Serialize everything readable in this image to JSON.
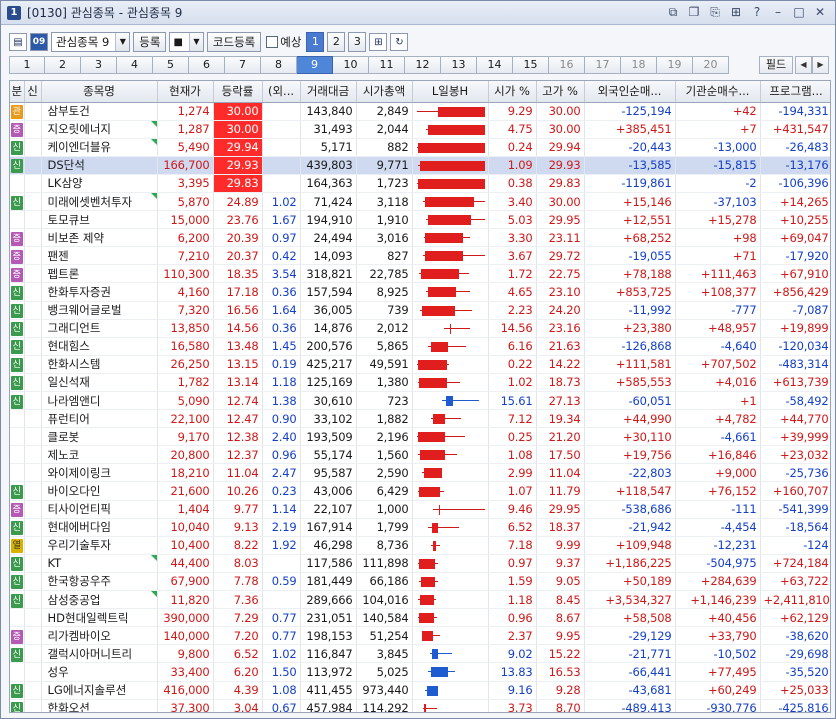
{
  "window": {
    "number": "1",
    "title": "[0130] 관심종목 - 관심종목 9",
    "controls": [
      "restore-icon",
      "copy-icon",
      "link-icon",
      "grid-icon",
      "help-icon",
      "minimize-icon",
      "maximize-icon",
      "close-icon"
    ]
  },
  "toolbar": {
    "group_select": "관심종목 9",
    "register_label": "등록",
    "code_register_label": "코드등록",
    "forecast_label": "예상",
    "pages": [
      "1",
      "2",
      "3"
    ],
    "active_page": "1"
  },
  "tabs": {
    "items": [
      "1",
      "2",
      "3",
      "4",
      "5",
      "6",
      "7",
      "8",
      "9",
      "10",
      "11",
      "12",
      "13",
      "14",
      "15",
      "16",
      "17",
      "18",
      "19",
      "20"
    ],
    "active": "9",
    "dim": [
      "16",
      "17",
      "18",
      "19",
      "20"
    ],
    "field_label": "필드"
  },
  "grid": {
    "headers": [
      "분",
      "신",
      "종목명",
      "현재가",
      "등락률",
      "(외...",
      "거래대금",
      "시가총액",
      "L일봉H",
      "시가 %",
      "고가 %",
      "외국인순매...",
      "기관순매수...",
      "프로그램..."
    ],
    "rows": [
      {
        "cat": "관",
        "name": "삼부토건",
        "price": "1,274",
        "rate": "30.00",
        "hot": true,
        "frgn": "",
        "amount": "143,840",
        "mcap": "2,849",
        "open": "9.29",
        "high": "30.00",
        "fnet": "-125,194",
        "inet": "+42",
        "pnet": "-194,331",
        "flag": false,
        "candle": {
          "o": 9.29,
          "c": 30.0,
          "h": 30.0,
          "l": 0.0
        }
      },
      {
        "cat": "증",
        "name": "지오릿에너지",
        "price": "1,287",
        "rate": "30.00",
        "hot": true,
        "frgn": "",
        "amount": "31,493",
        "mcap": "2,044",
        "open": "4.75",
        "high": "30.00",
        "fnet": "+385,451",
        "inet": "+7",
        "pnet": "+431,547",
        "flag": true,
        "candle": {
          "o": 4.75,
          "c": 30.0,
          "h": 30.0,
          "l": 4.0
        }
      },
      {
        "cat": "신",
        "name": "케이엔더블유",
        "price": "5,490",
        "rate": "29.94",
        "hot": true,
        "frgn": "",
        "amount": "5,171",
        "mcap": "882",
        "open": "0.24",
        "high": "29.94",
        "fnet": "-20,443",
        "inet": "-13,000",
        "pnet": "-26,483",
        "flag": true,
        "candle": {
          "o": 0.24,
          "c": 29.94,
          "h": 29.94,
          "l": 0.0
        }
      },
      {
        "cat": "신",
        "name": "DS단석",
        "price": "166,700",
        "rate": "29.93",
        "hot": true,
        "frgn": "",
        "amount": "439,803",
        "mcap": "9,771",
        "open": "1.09",
        "high": "29.93",
        "fnet": "-13,585",
        "inet": "-15,815",
        "pnet": "-13,176",
        "flag": false,
        "selected": true,
        "candle": {
          "o": 1.09,
          "c": 29.93,
          "h": 29.93,
          "l": 0.5
        }
      },
      {
        "cat": "",
        "name": "LK삼양",
        "price": "3,395",
        "rate": "29.83",
        "hot": true,
        "frgn": "",
        "amount": "164,363",
        "mcap": "1,723",
        "open": "0.38",
        "high": "29.83",
        "fnet": "-119,861",
        "inet": "-2",
        "pnet": "-106,396",
        "flag": false,
        "candle": {
          "o": 0.38,
          "c": 29.83,
          "h": 29.83,
          "l": 0.0
        }
      },
      {
        "cat": "신",
        "name": "미래에셋벤처투자",
        "price": "5,870",
        "rate": "24.89",
        "hot": false,
        "frgn": "1.02",
        "amount": "71,424",
        "mcap": "3,118",
        "open": "3.40",
        "high": "30.00",
        "fnet": "+15,146",
        "inet": "-37,103",
        "pnet": "+14,265",
        "flag": true,
        "candle": {
          "o": 3.4,
          "c": 24.89,
          "h": 30.0,
          "l": 2.5
        }
      },
      {
        "cat": "",
        "name": "토모큐브",
        "price": "15,000",
        "rate": "23.76",
        "hot": false,
        "frgn": "1.67",
        "amount": "194,910",
        "mcap": "1,910",
        "open": "5.03",
        "high": "29.95",
        "fnet": "+12,551",
        "inet": "+15,278",
        "pnet": "+10,255",
        "flag": false,
        "candle": {
          "o": 5.03,
          "c": 23.76,
          "h": 29.95,
          "l": 4.0
        }
      },
      {
        "cat": "증",
        "name": "비보존 제약",
        "price": "6,200",
        "rate": "20.39",
        "hot": false,
        "frgn": "0.97",
        "amount": "24,494",
        "mcap": "3,016",
        "open": "3.30",
        "high": "23.11",
        "fnet": "+68,252",
        "inet": "+98",
        "pnet": "+69,047",
        "flag": false,
        "candle": {
          "o": 3.3,
          "c": 20.39,
          "h": 23.11,
          "l": 3.0
        }
      },
      {
        "cat": "증",
        "name": "팬젠",
        "price": "7,210",
        "rate": "20.37",
        "hot": false,
        "frgn": "0.42",
        "amount": "14,093",
        "mcap": "827",
        "open": "3.67",
        "high": "29.72",
        "fnet": "-19,055",
        "inet": "+71",
        "pnet": "-17,920",
        "flag": false,
        "candle": {
          "o": 3.67,
          "c": 20.37,
          "h": 29.72,
          "l": 2.5
        }
      },
      {
        "cat": "증",
        "name": "펩트론",
        "price": "110,300",
        "rate": "18.35",
        "hot": false,
        "frgn": "3.54",
        "amount": "318,821",
        "mcap": "22,785",
        "open": "1.72",
        "high": "22.75",
        "fnet": "+78,188",
        "inet": "+111,463",
        "pnet": "+67,910",
        "flag": false,
        "candle": {
          "o": 1.72,
          "c": 18.35,
          "h": 22.75,
          "l": 1.0
        }
      },
      {
        "cat": "신",
        "name": "한화투자증권",
        "price": "4,160",
        "rate": "17.18",
        "hot": false,
        "frgn": "0.36",
        "amount": "157,594",
        "mcap": "8,925",
        "open": "4.65",
        "high": "23.10",
        "fnet": "+853,725",
        "inet": "+108,377",
        "pnet": "+856,429",
        "flag": false,
        "candle": {
          "o": 4.65,
          "c": 17.18,
          "h": 23.1,
          "l": 4.0
        }
      },
      {
        "cat": "신",
        "name": "뱅크웨어글로벌",
        "price": "7,320",
        "rate": "16.56",
        "hot": false,
        "frgn": "1.64",
        "amount": "36,005",
        "mcap": "739",
        "open": "2.23",
        "high": "24.20",
        "fnet": "-11,992",
        "inet": "-777",
        "pnet": "-7,087",
        "flag": false,
        "candle": {
          "o": 2.23,
          "c": 16.56,
          "h": 24.2,
          "l": 1.5
        }
      },
      {
        "cat": "신",
        "name": "그래디언트",
        "price": "13,850",
        "rate": "14.56",
        "hot": false,
        "frgn": "0.36",
        "amount": "14,876",
        "mcap": "2,012",
        "open": "14.56",
        "high": "23.16",
        "fnet": "+23,380",
        "inet": "+48,957",
        "pnet": "+19,899",
        "flag": false,
        "candle": {
          "o": 14.56,
          "c": 14.56,
          "h": 23.16,
          "l": 12.0
        }
      },
      {
        "cat": "신",
        "name": "현대힘스",
        "price": "16,580",
        "rate": "13.48",
        "hot": false,
        "frgn": "1.45",
        "amount": "200,576",
        "mcap": "5,865",
        "open": "6.16",
        "high": "21.63",
        "fnet": "-126,868",
        "inet": "-4,640",
        "pnet": "-120,034",
        "flag": false,
        "candle": {
          "o": 6.16,
          "c": 13.48,
          "h": 21.63,
          "l": 5.0
        }
      },
      {
        "cat": "신",
        "name": "한화시스템",
        "price": "26,250",
        "rate": "13.15",
        "hot": false,
        "frgn": "0.19",
        "amount": "425,217",
        "mcap": "49,591",
        "open": "0.22",
        "high": "14.22",
        "fnet": "+111,581",
        "inet": "+707,502",
        "pnet": "-483,314",
        "flag": false,
        "candle": {
          "o": 0.22,
          "c": 13.15,
          "h": 14.22,
          "l": 0.0
        }
      },
      {
        "cat": "신",
        "name": "일신석재",
        "price": "1,782",
        "rate": "13.14",
        "hot": false,
        "frgn": "1.18",
        "amount": "125,169",
        "mcap": "1,380",
        "open": "1.02",
        "high": "18.73",
        "fnet": "+585,553",
        "inet": "+4,016",
        "pnet": "+613,739",
        "flag": false,
        "candle": {
          "o": 1.02,
          "c": 13.14,
          "h": 18.73,
          "l": 0.5
        }
      },
      {
        "cat": "신",
        "name": "나라엠앤디",
        "price": "5,090",
        "rate": "12.74",
        "hot": false,
        "frgn": "1.38",
        "amount": "30,610",
        "mcap": "723",
        "open": "15.61",
        "high": "27.13",
        "fnet": "-60,051",
        "inet": "+1",
        "pnet": "-58,492",
        "flag": false,
        "blue": true,
        "candle": {
          "o": 15.61,
          "c": 12.74,
          "h": 27.13,
          "l": 11.0
        }
      },
      {
        "cat": "",
        "name": "퓨런티어",
        "price": "22,100",
        "rate": "12.47",
        "hot": false,
        "frgn": "0.90",
        "amount": "33,102",
        "mcap": "1,882",
        "open": "7.12",
        "high": "19.34",
        "fnet": "+44,990",
        "inet": "+4,782",
        "pnet": "+44,770",
        "flag": false,
        "candle": {
          "o": 7.12,
          "c": 12.47,
          "h": 19.34,
          "l": 6.0
        }
      },
      {
        "cat": "",
        "name": "클로봇",
        "price": "9,170",
        "rate": "12.38",
        "hot": false,
        "frgn": "2.40",
        "amount": "193,509",
        "mcap": "2,196",
        "open": "0.25",
        "high": "21.20",
        "fnet": "+30,110",
        "inet": "-4,661",
        "pnet": "+39,999",
        "flag": false,
        "candle": {
          "o": 0.25,
          "c": 12.38,
          "h": 21.2,
          "l": 0.0
        }
      },
      {
        "cat": "",
        "name": "제노코",
        "price": "20,800",
        "rate": "12.37",
        "hot": false,
        "frgn": "0.96",
        "amount": "55,174",
        "mcap": "1,560",
        "open": "1.08",
        "high": "17.50",
        "fnet": "+19,756",
        "inet": "+16,846",
        "pnet": "+23,032",
        "flag": false,
        "candle": {
          "o": 1.08,
          "c": 12.37,
          "h": 17.5,
          "l": 0.5
        }
      },
      {
        "cat": "",
        "name": "와이제이링크",
        "price": "18,210",
        "rate": "11.04",
        "hot": false,
        "frgn": "2.47",
        "amount": "95,587",
        "mcap": "2,590",
        "open": "2.99",
        "high": "11.04",
        "fnet": "-22,803",
        "inet": "+9,000",
        "pnet": "-25,736",
        "flag": false,
        "candle": {
          "o": 2.99,
          "c": 11.04,
          "h": 11.04,
          "l": 2.0
        }
      },
      {
        "cat": "신",
        "name": "바이오다인",
        "price": "21,600",
        "rate": "10.26",
        "hot": false,
        "frgn": "0.23",
        "amount": "43,006",
        "mcap": "6,429",
        "open": "1.07",
        "high": "11.79",
        "fnet": "+118,547",
        "inet": "+76,152",
        "pnet": "+160,707",
        "flag": false,
        "candle": {
          "o": 1.07,
          "c": 10.26,
          "h": 11.79,
          "l": 0.5
        }
      },
      {
        "cat": "증",
        "name": "티사이언티픽",
        "price": "1,404",
        "rate": "9.77",
        "hot": false,
        "frgn": "1.14",
        "amount": "22,107",
        "mcap": "1,000",
        "open": "9.46",
        "high": "29.95",
        "fnet": "-538,686",
        "inet": "-111",
        "pnet": "-541,399",
        "flag": false,
        "candle": {
          "o": 9.46,
          "c": 9.77,
          "h": 29.95,
          "l": 7.0
        }
      },
      {
        "cat": "신",
        "name": "현대에버다임",
        "price": "10,040",
        "rate": "9.13",
        "hot": false,
        "frgn": "2.19",
        "amount": "167,914",
        "mcap": "1,799",
        "open": "6.52",
        "high": "18.37",
        "fnet": "-21,942",
        "inet": "-4,454",
        "pnet": "-18,564",
        "flag": false,
        "candle": {
          "o": 6.52,
          "c": 9.13,
          "h": 18.37,
          "l": 5.0
        }
      },
      {
        "cat": "열",
        "name": "우리기술투자",
        "price": "10,400",
        "rate": "8.22",
        "hot": false,
        "frgn": "1.92",
        "amount": "46,298",
        "mcap": "8,736",
        "open": "7.18",
        "high": "9.99",
        "fnet": "+109,948",
        "inet": "-12,231",
        "pnet": "-124",
        "flag": false,
        "candle": {
          "o": 7.18,
          "c": 8.22,
          "h": 9.99,
          "l": 6.0
        }
      },
      {
        "cat": "신",
        "name": "KT",
        "price": "44,400",
        "rate": "8.03",
        "hot": false,
        "frgn": "",
        "amount": "117,586",
        "mcap": "111,898",
        "open": "0.97",
        "high": "9.37",
        "fnet": "+1,186,225",
        "inet": "-504,975",
        "pnet": "+724,184",
        "flag": true,
        "candle": {
          "o": 0.97,
          "c": 8.03,
          "h": 9.37,
          "l": 0.5
        }
      },
      {
        "cat": "신",
        "name": "한국항공우주",
        "price": "67,900",
        "rate": "7.78",
        "hot": false,
        "frgn": "0.59",
        "amount": "181,449",
        "mcap": "66,186",
        "open": "1.59",
        "high": "9.05",
        "fnet": "+50,189",
        "inet": "+284,639",
        "pnet": "+63,722",
        "flag": false,
        "candle": {
          "o": 1.59,
          "c": 7.78,
          "h": 9.05,
          "l": 1.0
        }
      },
      {
        "cat": "신",
        "name": "삼성중공업",
        "price": "11,820",
        "rate": "7.36",
        "hot": false,
        "frgn": "",
        "amount": "289,666",
        "mcap": "104,016",
        "open": "1.18",
        "high": "8.45",
        "fnet": "+3,534,327",
        "inet": "+1,146,239",
        "pnet": "+2,411,810",
        "flag": true,
        "candle": {
          "o": 1.18,
          "c": 7.36,
          "h": 8.45,
          "l": 0.5
        }
      },
      {
        "cat": "",
        "name": "HD현대일렉트릭",
        "price": "390,000",
        "rate": "7.29",
        "hot": false,
        "frgn": "0.77",
        "amount": "231,051",
        "mcap": "140,584",
        "open": "0.96",
        "high": "8.67",
        "fnet": "+58,508",
        "inet": "+40,456",
        "pnet": "+62,129",
        "flag": false,
        "candle": {
          "o": 0.96,
          "c": 7.29,
          "h": 8.67,
          "l": 0.5
        }
      },
      {
        "cat": "증",
        "name": "리가켐바이오",
        "price": "140,000",
        "rate": "7.20",
        "hot": false,
        "frgn": "0.77",
        "amount": "198,153",
        "mcap": "51,254",
        "open": "2.37",
        "high": "9.95",
        "fnet": "-29,129",
        "inet": "+33,790",
        "pnet": "-38,620",
        "flag": false,
        "candle": {
          "o": 2.37,
          "c": 7.2,
          "h": 9.95,
          "l": 2.0
        }
      },
      {
        "cat": "신",
        "name": "갤럭시아머니트리",
        "price": "9,800",
        "rate": "6.52",
        "hot": false,
        "frgn": "1.02",
        "amount": "116,847",
        "mcap": "3,845",
        "open": "9.02",
        "high": "15.22",
        "fnet": "-21,771",
        "inet": "-10,502",
        "pnet": "-29,698",
        "flag": false,
        "blue": true,
        "candle": {
          "o": 9.02,
          "c": 6.52,
          "h": 15.22,
          "l": 5.5
        }
      },
      {
        "cat": "",
        "name": "성우",
        "price": "33,400",
        "rate": "6.20",
        "hot": false,
        "frgn": "1.50",
        "amount": "113,972",
        "mcap": "5,025",
        "open": "13.83",
        "high": "16.53",
        "fnet": "-66,441",
        "inet": "+77,495",
        "pnet": "-35,520",
        "flag": false,
        "blue": true,
        "candle": {
          "o": 13.83,
          "c": 6.2,
          "h": 16.53,
          "l": 5.0
        }
      },
      {
        "cat": "신",
        "name": "LG에너지솔루션",
        "price": "416,000",
        "rate": "4.39",
        "hot": false,
        "frgn": "1.08",
        "amount": "411,455",
        "mcap": "973,440",
        "open": "9.16",
        "high": "9.28",
        "fnet": "-43,681",
        "inet": "+60,249",
        "pnet": "+25,033",
        "flag": false,
        "blue": true,
        "candle": {
          "o": 9.16,
          "c": 4.39,
          "h": 9.28,
          "l": 3.5
        }
      },
      {
        "cat": "신",
        "name": "한화오션",
        "price": "37,300",
        "rate": "3.04",
        "hot": false,
        "frgn": "0.67",
        "amount": "457,984",
        "mcap": "114,292",
        "open": "3.73",
        "high": "8.70",
        "fnet": "-489,413",
        "inet": "-930,776",
        "pnet": "-425,816",
        "flag": false,
        "candle": {
          "o": 3.73,
          "c": 3.04,
          "h": 8.7,
          "l": 2.5
        }
      }
    ]
  }
}
